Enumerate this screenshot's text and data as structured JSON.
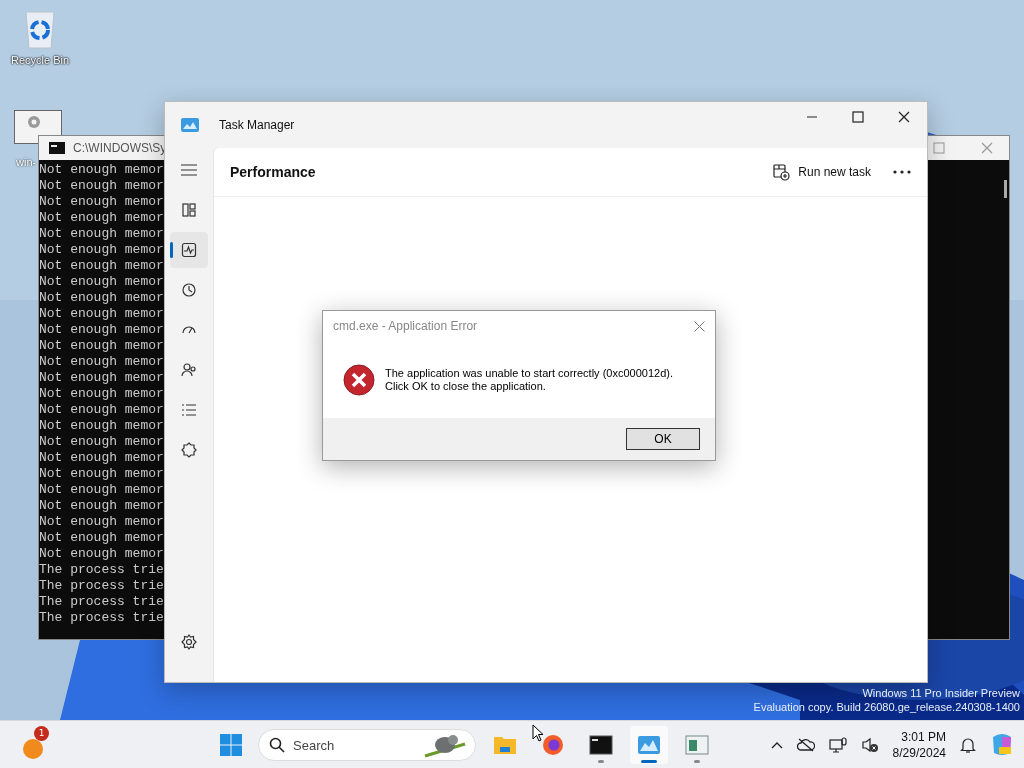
{
  "desktop_icons": [
    {
      "kind": "recycle",
      "label": "Recycle Bin"
    },
    {
      "kind": "window",
      "label": "win-"
    }
  ],
  "console": {
    "title": "C:\\WINDOWS\\Sy",
    "lines": [
      "Not enough memor",
      "Not enough memor",
      "Not enough memor",
      "Not enough memor",
      "Not enough memor",
      "Not enough memor",
      "Not enough memor",
      "Not enough memor",
      "Not enough memor",
      "Not enough memor",
      "Not enough memor",
      "Not enough memor",
      "Not enough memor",
      "Not enough memor",
      "Not enough memor",
      "Not enough memor",
      "Not enough memor",
      "Not enough memor",
      "Not enough memor",
      "Not enough memor",
      "Not enough memor",
      "Not enough memor",
      "Not enough memor",
      "Not enough memor",
      "Not enough memor",
      "The process trie",
      "The process trie",
      "The process trie",
      "The process trie"
    ]
  },
  "task_manager": {
    "title": "Task Manager",
    "page_title": "Performance",
    "run_new_task": "Run new task",
    "nav": [
      {
        "selected": false
      },
      {
        "selected": true
      },
      {
        "selected": false
      },
      {
        "selected": false
      },
      {
        "selected": false
      },
      {
        "selected": false
      },
      {
        "selected": false
      }
    ]
  },
  "dialog": {
    "title": "cmd.exe - Application Error",
    "message": "The application was unable to start correctly (0xc000012d).",
    "message_2": "Click OK to close the application.",
    "button": "OK"
  },
  "watermark": [
    "Windows 11 Pro Insider Preview",
    "Evaluation copy. Build 26080.ge_release.240308-1400"
  ],
  "taskbar": {
    "widget_badge": "1",
    "search_placeholder": "Search",
    "apps": [
      {
        "kind": "explorer",
        "running": false,
        "active": false
      },
      {
        "kind": "firefox",
        "running": false,
        "active": false
      },
      {
        "kind": "terminal",
        "running": true,
        "active": false
      },
      {
        "kind": "taskmgr",
        "running": true,
        "active": true
      },
      {
        "kind": "app",
        "running": true,
        "active": false
      }
    ],
    "time": "3:01 PM",
    "date": "8/29/2024"
  }
}
